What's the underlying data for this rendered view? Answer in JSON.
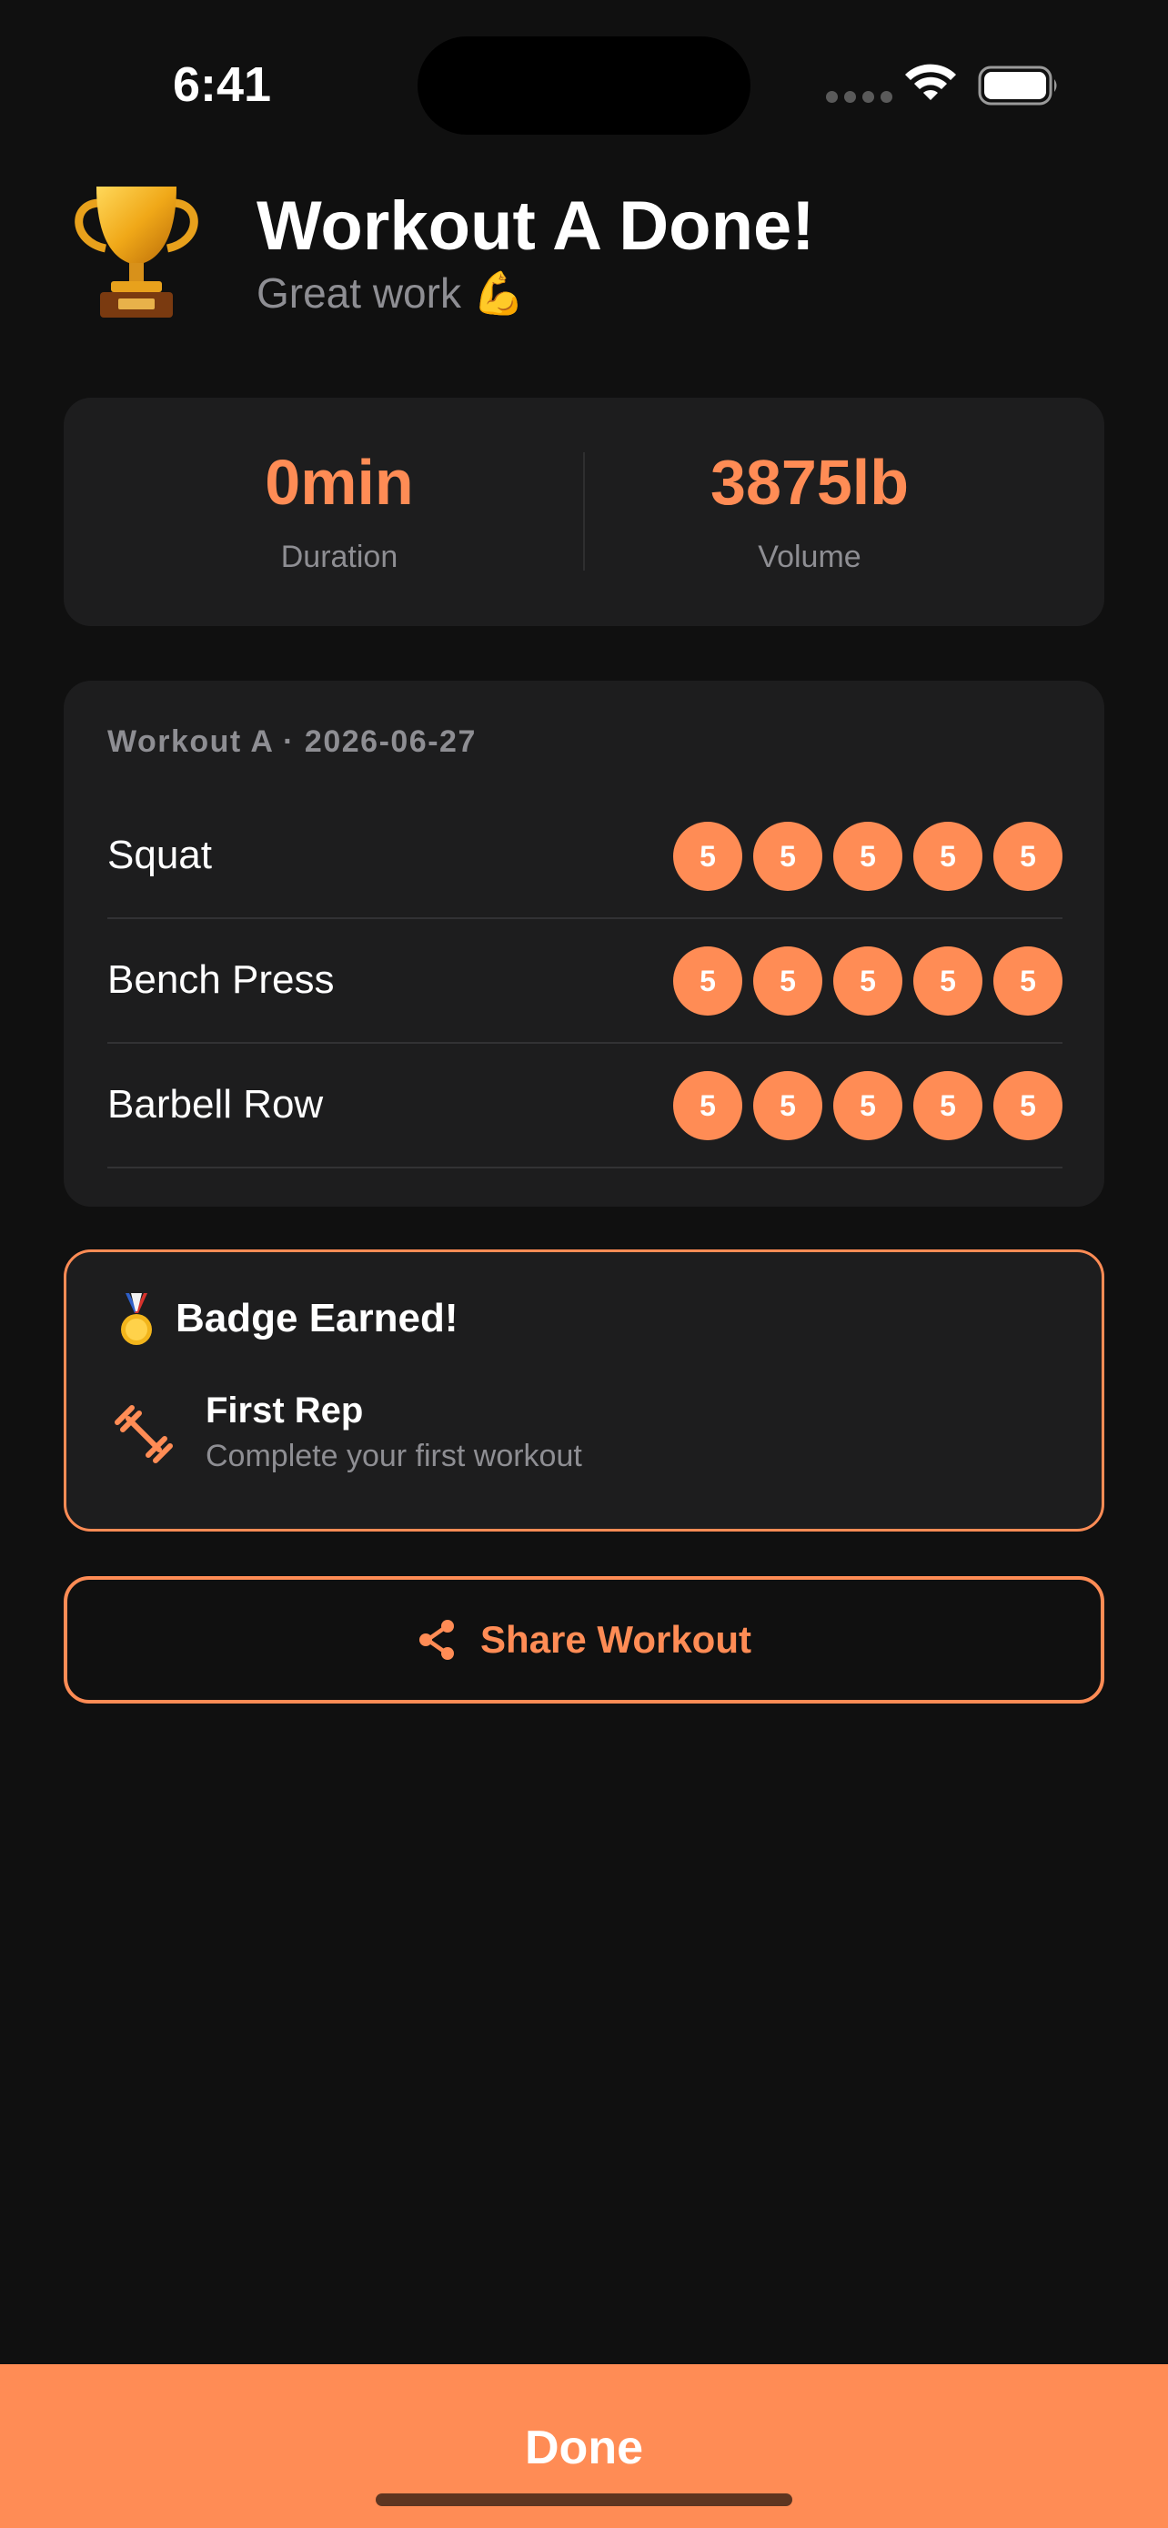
{
  "status_bar": {
    "time": "6:41"
  },
  "header": {
    "title": "Workout A Done!",
    "subtitle": "Great work 💪",
    "icon": "trophy-icon"
  },
  "stats": {
    "duration": {
      "value": "0min",
      "label": "Duration"
    },
    "volume": {
      "value": "3875lb",
      "label": "Volume"
    }
  },
  "workout": {
    "meta": "Workout A · 2026-06-27",
    "exercises": [
      {
        "name": "Squat",
        "reps": [
          "5",
          "5",
          "5",
          "5",
          "5"
        ]
      },
      {
        "name": "Bench Press",
        "reps": [
          "5",
          "5",
          "5",
          "5",
          "5"
        ]
      },
      {
        "name": "Barbell Row",
        "reps": [
          "5",
          "5",
          "5",
          "5",
          "5"
        ]
      }
    ]
  },
  "badge": {
    "heading": "Badge Earned!",
    "icon": "medal-icon",
    "name": "First Rep",
    "description": "Complete your first workout",
    "badge_icon": "dumbbell-icon"
  },
  "actions": {
    "share_label": "Share Workout",
    "done_label": "Done"
  },
  "colors": {
    "accent": "#ff8c55",
    "background": "#101010",
    "card": "#1d1d1e",
    "muted_text": "#8e8e93"
  }
}
